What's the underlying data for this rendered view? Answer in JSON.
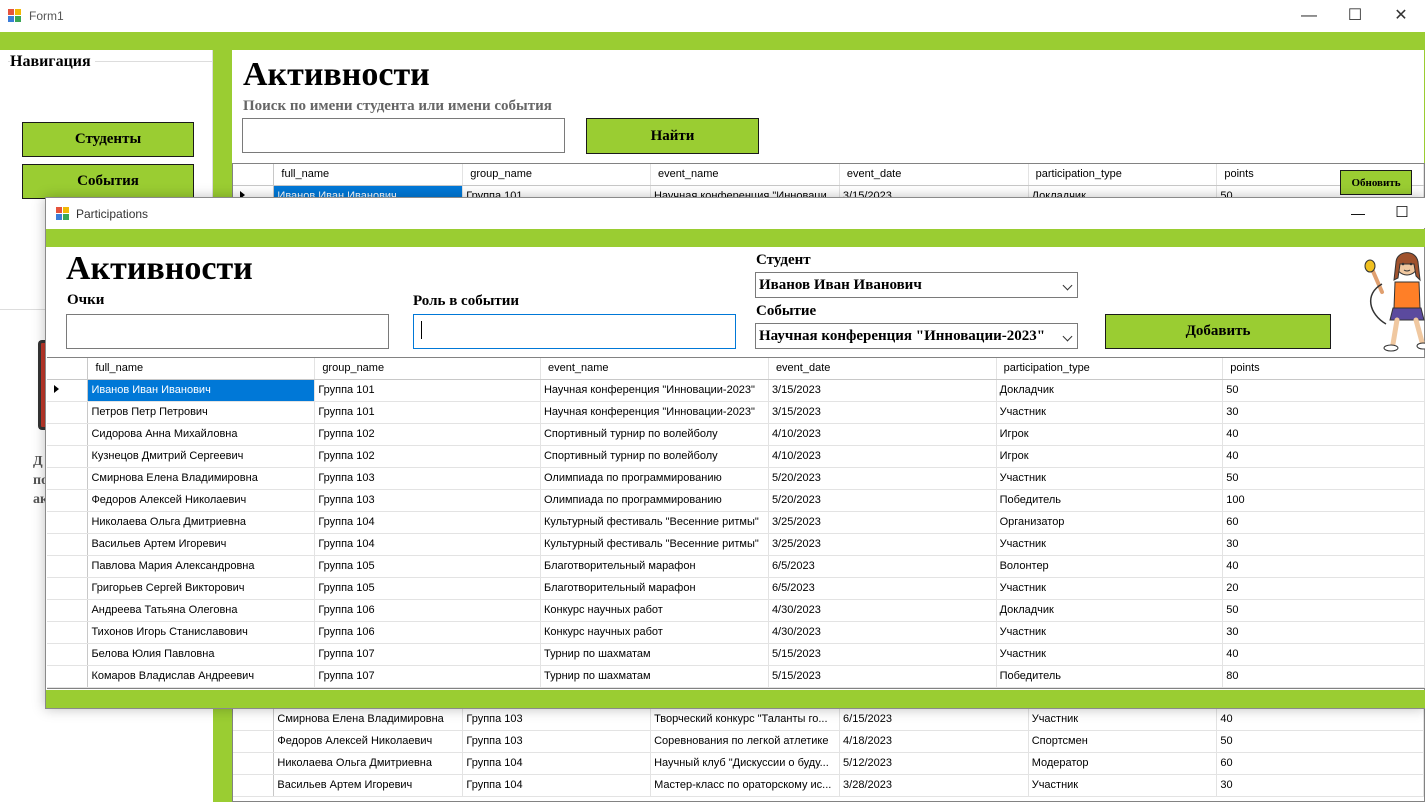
{
  "main_window": {
    "title": "Form1",
    "nav": {
      "header": "Навигация",
      "students_button": "Студенты",
      "events_button": "События",
      "partial_text": [
        "Д",
        "по",
        "ак"
      ]
    },
    "heading": "Активности",
    "search_label": "Поиск по имени студента или имени события",
    "search_value": "",
    "search_button": "Найти",
    "refresh_button": "Обновить",
    "grid": {
      "columns": [
        "full_name",
        "group_name",
        "event_name",
        "event_date",
        "participation_type",
        "points"
      ],
      "top_row": [
        "Иванов Иван Иванович",
        "Группа 101",
        "Научная конференция \"Инноваци",
        "3/15/2023",
        "Докладчик",
        "50"
      ],
      "bottom_rows": [
        [
          "Смирнова Елена Владимировна",
          "Группа 103",
          "Творческий конкурс \"Таланты го...",
          "6/15/2023",
          "Участник",
          "40"
        ],
        [
          "Федоров Алексей Николаевич",
          "Группа 103",
          "Соревнования по легкой атлетике",
          "4/18/2023",
          "Спортсмен",
          "50"
        ],
        [
          "Николаева Ольга Дмитриевна",
          "Группа 104",
          "Научный клуб \"Дискуссии о буду...",
          "5/12/2023",
          "Модератор",
          "60"
        ],
        [
          "Васильев Артем Игоревич",
          "Группа 104",
          "Мастер-класс по ораторскому ис...",
          "3/28/2023",
          "Участник",
          "30"
        ]
      ]
    }
  },
  "dialog": {
    "title": "Participations",
    "heading": "Активности",
    "points_label": "Очки",
    "points_value": "",
    "role_label": "Роль в событии",
    "role_value": "",
    "student_label": "Студент",
    "student_value": "Иванов Иван Иванович",
    "event_label": "Событие",
    "event_value": "Научная конференция \"Инновации-2023\"",
    "add_button": "Добавить",
    "grid": {
      "columns": [
        "full_name",
        "group_name",
        "event_name",
        "event_date",
        "participation_type",
        "points"
      ],
      "rows": [
        [
          "Иванов Иван Иванович",
          "Группа 101",
          "Научная конференция \"Инновации-2023\"",
          "3/15/2023",
          "Докладчик",
          "50"
        ],
        [
          "Петров Петр Петрович",
          "Группа 101",
          "Научная конференция \"Инновации-2023\"",
          "3/15/2023",
          "Участник",
          "30"
        ],
        [
          "Сидорова Анна Михайловна",
          "Группа 102",
          "Спортивный турнир по волейболу",
          "4/10/2023",
          "Игрок",
          "40"
        ],
        [
          "Кузнецов Дмитрий Сергеевич",
          "Группа 102",
          "Спортивный турнир по волейболу",
          "4/10/2023",
          "Игрок",
          "40"
        ],
        [
          "Смирнова Елена Владимировна",
          "Группа 103",
          "Олимпиада по программированию",
          "5/20/2023",
          "Участник",
          "50"
        ],
        [
          "Федоров Алексей Николаевич",
          "Группа 103",
          "Олимпиада по программированию",
          "5/20/2023",
          "Победитель",
          "100"
        ],
        [
          "Николаева Ольга Дмитриевна",
          "Группа 104",
          "Культурный фестиваль \"Весенние ритмы\"",
          "3/25/2023",
          "Организатор",
          "60"
        ],
        [
          "Васильев Артем Игоревич",
          "Группа 104",
          "Культурный фестиваль \"Весенние ритмы\"",
          "3/25/2023",
          "Участник",
          "30"
        ],
        [
          "Павлова Мария Александровна",
          "Группа 105",
          "Благотворительный марафон",
          "6/5/2023",
          "Волонтер",
          "40"
        ],
        [
          "Григорьев Сергей Викторович",
          "Группа 105",
          "Благотворительный марафон",
          "6/5/2023",
          "Участник",
          "20"
        ],
        [
          "Андреева Татьяна Олеговна",
          "Группа 106",
          "Конкурс научных работ",
          "4/30/2023",
          "Докладчик",
          "50"
        ],
        [
          "Тихонов Игорь Станиславович",
          "Группа 106",
          "Конкурс научных работ",
          "4/30/2023",
          "Участник",
          "30"
        ],
        [
          "Белова Юлия Павловна",
          "Группа 107",
          "Турнир по шахматам",
          "5/15/2023",
          "Участник",
          "40"
        ],
        [
          "Комаров Владислав Андреевич",
          "Группа 107",
          "Турнир по шахматам",
          "5/15/2023",
          "Победитель",
          "80"
        ]
      ]
    }
  },
  "colors": {
    "accent_green": "#9acd32",
    "selection_blue": "#0078d7"
  },
  "icons": [
    "app-icon",
    "minimize-icon",
    "maximize-icon",
    "close-icon",
    "row-pointer-icon",
    "dropdown-chevron-icon",
    "cheerleader-illustration"
  ]
}
